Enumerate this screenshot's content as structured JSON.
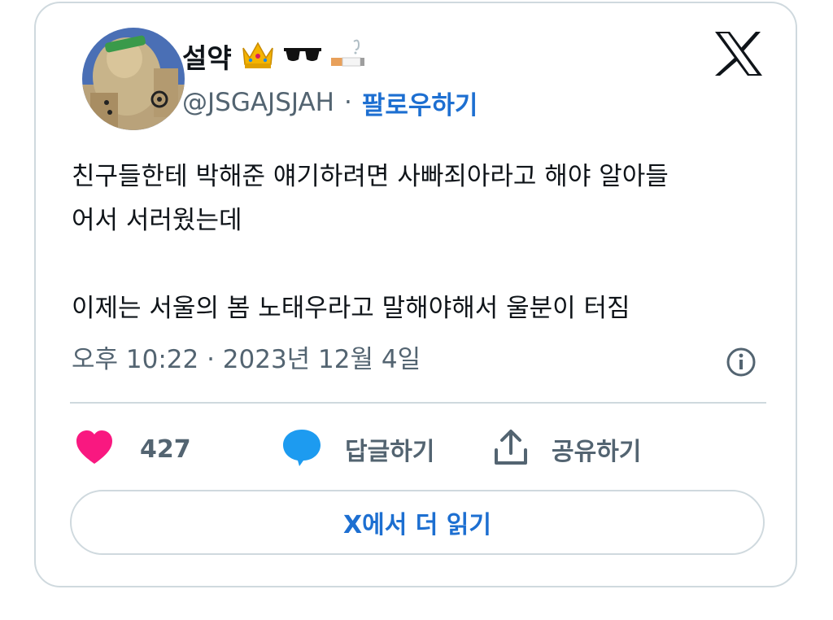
{
  "author": {
    "display_name": "설약",
    "name_emojis": [
      "crown-emoji",
      "sunglasses-emoji",
      "cigarette-emoji"
    ],
    "handle": "@JSGAJSJAH",
    "separator": "·",
    "follow_label": "팔로우하기"
  },
  "tweet": {
    "line1": "친구들한테 박해준 얘기하려면 사빠죄아라고 해야 알아들",
    "line2": "어서 서러웠는데",
    "line3": "이제는 서울의 봄 노태우라고 말해야해서 울분이 터짐",
    "timestamp": "오후 10:22 · 2023년 12월 4일"
  },
  "actions": {
    "like_count": "427",
    "reply_label": "답글하기",
    "share_label": "공유하기"
  },
  "read_more_label": "X에서 더 읽기",
  "colors": {
    "link_blue": "#1d6fd1",
    "heart_pink": "#f91880",
    "reply_blue": "#1d9bf0",
    "muted_gray": "#536471",
    "border_gray": "#cfd9de"
  }
}
